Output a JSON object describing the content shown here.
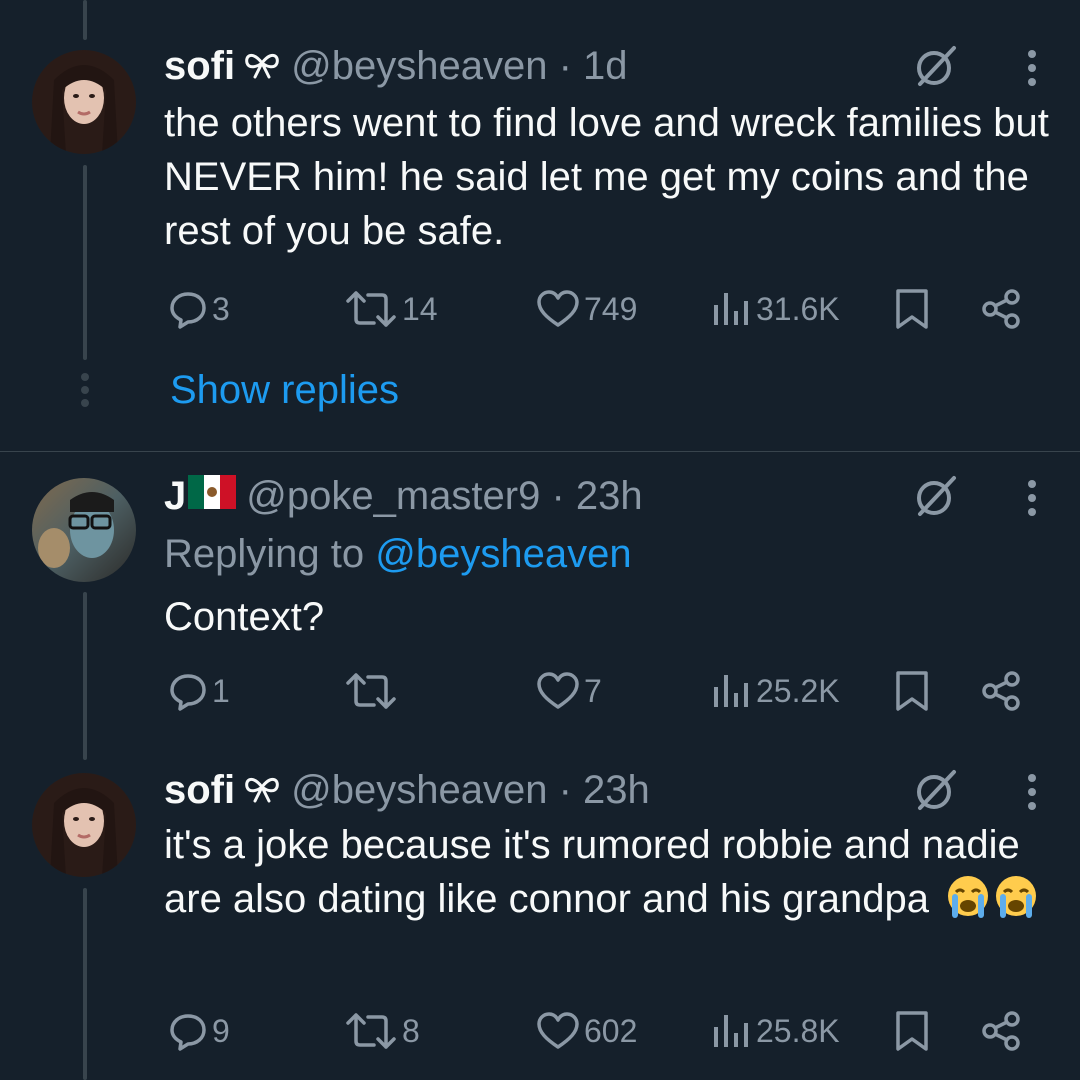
{
  "posts": [
    {
      "name": "sofi",
      "badge": "ribbon-icon",
      "handle_time": "@beysheaven · 1d",
      "text": "the others went to find love and wreck families but NEVER him! he said let me get my coins and the rest of you be safe.",
      "replies": "3",
      "reposts": "14",
      "likes": "749",
      "views": "31.6K"
    },
    {
      "name": "J",
      "badge": "mexico-flag-icon",
      "handle_time": "@poke_master9 · 23h",
      "replying_prefix": "Replying to",
      "replying_handle": "@beysheaven",
      "text": "Context?",
      "replies": "1",
      "reposts": "",
      "likes": "7",
      "views": "25.2K"
    },
    {
      "name": "sofi",
      "badge": "ribbon-icon",
      "handle_time": "@beysheaven · 23h",
      "text": "it's a joke because it's rumored robbie and nadie are also dating like connor and his grandpa",
      "text_emoji": "crying-face-emoji x2",
      "replies": "9",
      "reposts": "8",
      "likes": "602",
      "views": "25.8K"
    }
  ],
  "show_replies_label": "Show replies",
  "colors": {
    "background": "#15202b",
    "text": "#f7f9f9",
    "muted": "#8b98a5",
    "link": "#1d9bf0",
    "divider": "#38444d"
  }
}
